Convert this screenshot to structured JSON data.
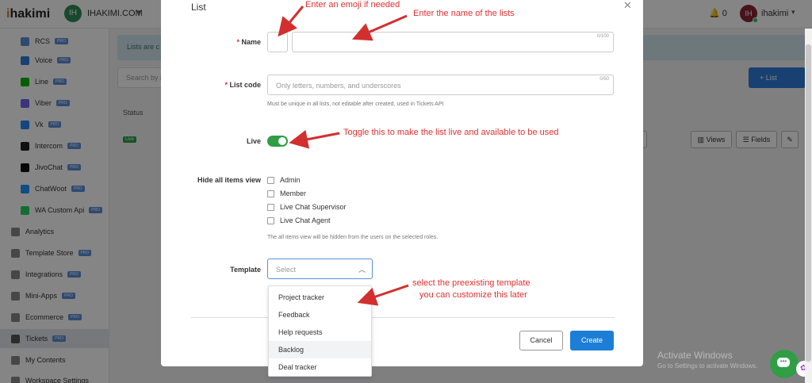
{
  "topbar": {
    "logo_prefix": "i",
    "logo_rest": "hakimi",
    "workspace_avatar": "IH",
    "workspace_name": "IHAKIMI.COM",
    "notification_count": "0",
    "user_avatar": "IH",
    "user_name": "ihakimi"
  },
  "sidebar": {
    "pro_label": "PRO",
    "items": [
      {
        "label": "RCS",
        "icon": "rcs-icon",
        "color": "#5b8fd9"
      },
      {
        "label": "Voice",
        "icon": "voice-icon",
        "color": "#2f7bd6"
      },
      {
        "label": "Line",
        "icon": "line-icon",
        "color": "#00b900"
      },
      {
        "label": "Viber",
        "icon": "viber-icon",
        "color": "#7360f2"
      },
      {
        "label": "Vk",
        "icon": "vk-icon",
        "color": "#2787f5"
      },
      {
        "label": "Intercom",
        "icon": "intercom-icon",
        "color": "#222222"
      },
      {
        "label": "JivoChat",
        "icon": "jivochat-icon",
        "color": "#111111"
      },
      {
        "label": "ChatWoot",
        "icon": "chatwoot-icon",
        "color": "#1f93ff"
      },
      {
        "label": "WA Custom Api",
        "icon": "whatsapp-icon",
        "color": "#25d366"
      },
      {
        "label": "Analytics",
        "icon": "analytics-icon",
        "color": "#888888"
      },
      {
        "label": "Template Store",
        "icon": "template-store-icon",
        "color": "#888888"
      },
      {
        "label": "Integrations",
        "icon": "integrations-icon",
        "color": "#888888"
      },
      {
        "label": "Mini-Apps",
        "icon": "mini-apps-icon",
        "color": "#888888"
      },
      {
        "label": "Ecommerce",
        "icon": "ecommerce-icon",
        "color": "#888888"
      },
      {
        "label": "Tickets",
        "icon": "tickets-icon",
        "color": "#555555"
      },
      {
        "label": "My Contents",
        "icon": "contents-icon",
        "color": "#888888"
      },
      {
        "label": "Workspace Settings",
        "icon": "settings-icon",
        "color": "#888888"
      }
    ]
  },
  "background": {
    "banner_text": "Lists are c",
    "search_placeholder": "Search by i",
    "add_list_label": "+ List",
    "status_header": "Status",
    "live_tag": "Live",
    "views_label": "Views",
    "fields_label": "Fields"
  },
  "modal": {
    "title": "List",
    "name_label": "Name",
    "name_counter": "0/100",
    "list_code_label": "List code",
    "list_code_placeholder": "Only letters, numbers, and underscores",
    "list_code_counter": "0/50",
    "list_code_help": "Must be unique in all lists, not editable after created, used in Tickets API",
    "live_label": "Live",
    "live_on": true,
    "hide_label": "Hide all items view",
    "roles": [
      "Admin",
      "Member",
      "Live Chat Supervisor",
      "Live Chat Agent"
    ],
    "hide_help": "The all items view will be hidden from the users on the selected roles.",
    "template_label": "Template",
    "template_placeholder": "Select",
    "template_options": [
      "Project tracker",
      "Feedback",
      "Help requests",
      "Backlog",
      "Deal tracker"
    ],
    "cancel_label": "Cancel",
    "create_label": "Create"
  },
  "annotations": {
    "emoji": "Enter an emoji if needed",
    "name": "Enter the name of the lists",
    "toggle": "Toggle this to make the list live and available to be used",
    "template_line1": "select the preexisting template",
    "template_line2": "you can customize  this later"
  },
  "watermark": {
    "line1": "Activate Windows",
    "line2": "Go to Settings to activate Windows."
  }
}
